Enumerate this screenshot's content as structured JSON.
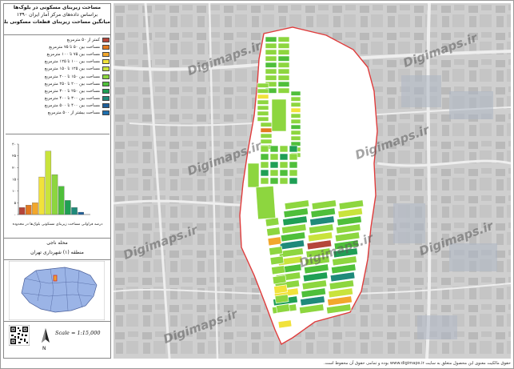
{
  "title": {
    "line1": "مساحت زیربنای مسکونی در بلوک‌ها",
    "line2": "براساس داده‌های مرکز آمار ایران ۱۳۹۰"
  },
  "legend": {
    "title": "میانگین مساحت زیربنای قطعات مسکونی بلوک‌ها",
    "items": [
      {
        "label": "کمتر از ۵۰ مترمربع",
        "color": "#b5453a"
      },
      {
        "label": "مساحت بین ۵۰ تا ۷۵ مترمربع",
        "color": "#e2791f"
      },
      {
        "label": "مساحت بین ۷۵ تا ۱۰۰ مترمربع",
        "color": "#f2a72c"
      },
      {
        "label": "مساحت بین ۱۰۰ تا ۱۲۵ مترمربع",
        "color": "#f1e23b"
      },
      {
        "label": "مساحت بین ۱۲۵ تا ۱۵۰ مترمربع",
        "color": "#c9e33c"
      },
      {
        "label": "مساحت بین ۱۵۰ تا ۲۰۰ مترمربع",
        "color": "#8dd63f"
      },
      {
        "label": "مساحت بین ۲۰۰ تا ۲۵۰ مترمربع",
        "color": "#4fbf3a"
      },
      {
        "label": "مساحت بین ۲۵۰ تا ۳۰۰ مترمربع",
        "color": "#1f9f55"
      },
      {
        "label": "مساحت بین ۳۰۰ تا ۴۰۰ مترمربع",
        "color": "#1f8a7a"
      },
      {
        "label": "مساحت بین ۴۰۰ تا ۵۰۰ مترمربع",
        "color": "#1f5f9a"
      },
      {
        "label": "مساحت بیشتر از ۵۰۰ مترمربع",
        "color": "#1d6fae"
      }
    ]
  },
  "histogram": {
    "caption": "درصد فراوانی مساحت زیربنای مسکونی بلوک‌ها در محدوده",
    "values": [
      3,
      4,
      5,
      16,
      27,
      17,
      12,
      6,
      3,
      1,
      0
    ],
    "ymax": 30,
    "ticks": [
      "۰",
      "۵",
      "۱۰",
      "۱۵",
      "۲۰",
      "۲۵",
      "۳۰"
    ]
  },
  "location": {
    "line1": "محله ناجی",
    "line2": "منطقه (۱) شهرداری تهران"
  },
  "scale_text": "Scale = 1:15,000",
  "north_label": "N",
  "footer_text": "حقوق مالکیت معنوی این محصول متعلق به سایت www.digimaps.ir بوده و تمامی حقوق آن محفوظ است.",
  "watermark": "Digimaps.ir",
  "colors": {
    "boundary": "#e03c3c",
    "map_bg": "#c9c9c9",
    "inset_fill": "#9bb4e6"
  }
}
